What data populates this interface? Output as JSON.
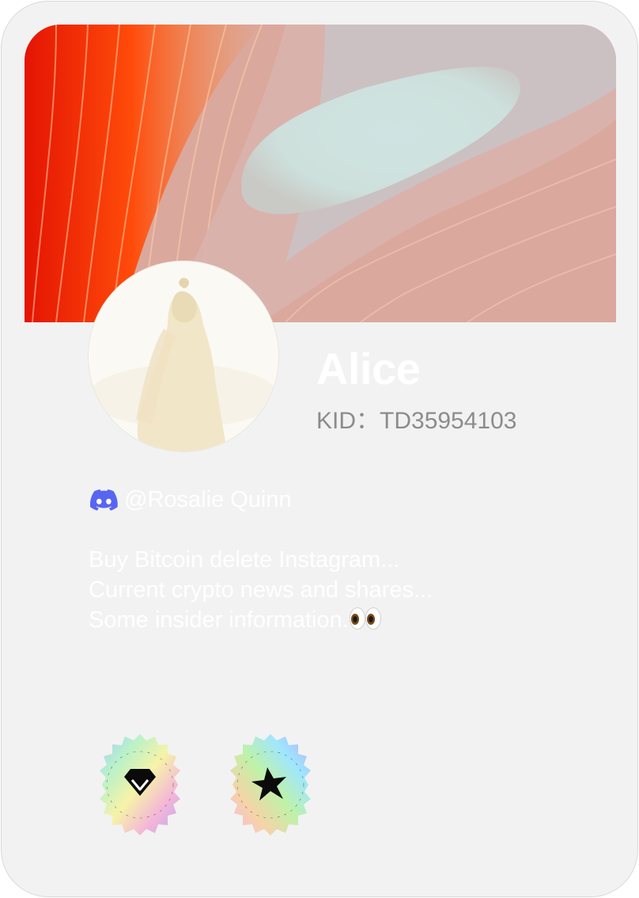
{
  "profile": {
    "name": "Alice",
    "kid_label": "KID：",
    "kid_value": "TD35954103",
    "discord_handle": "@Rosalie Quinn",
    "bio_lines": [
      "Buy Bitcoin delete Instagram...",
      "Current crypto news and shares...",
      "Some insider information."
    ]
  },
  "badges": [
    {
      "icon": "gem-icon",
      "ring_text": "KIKK"
    },
    {
      "icon": "star-burst-icon",
      "ring_text": "KIKK"
    }
  ],
  "colors": {
    "card_background": "#f2f2f2",
    "discord_blue": "#5865f2",
    "kid_text": "#8c8c8c",
    "name_text": "#ffffff"
  }
}
